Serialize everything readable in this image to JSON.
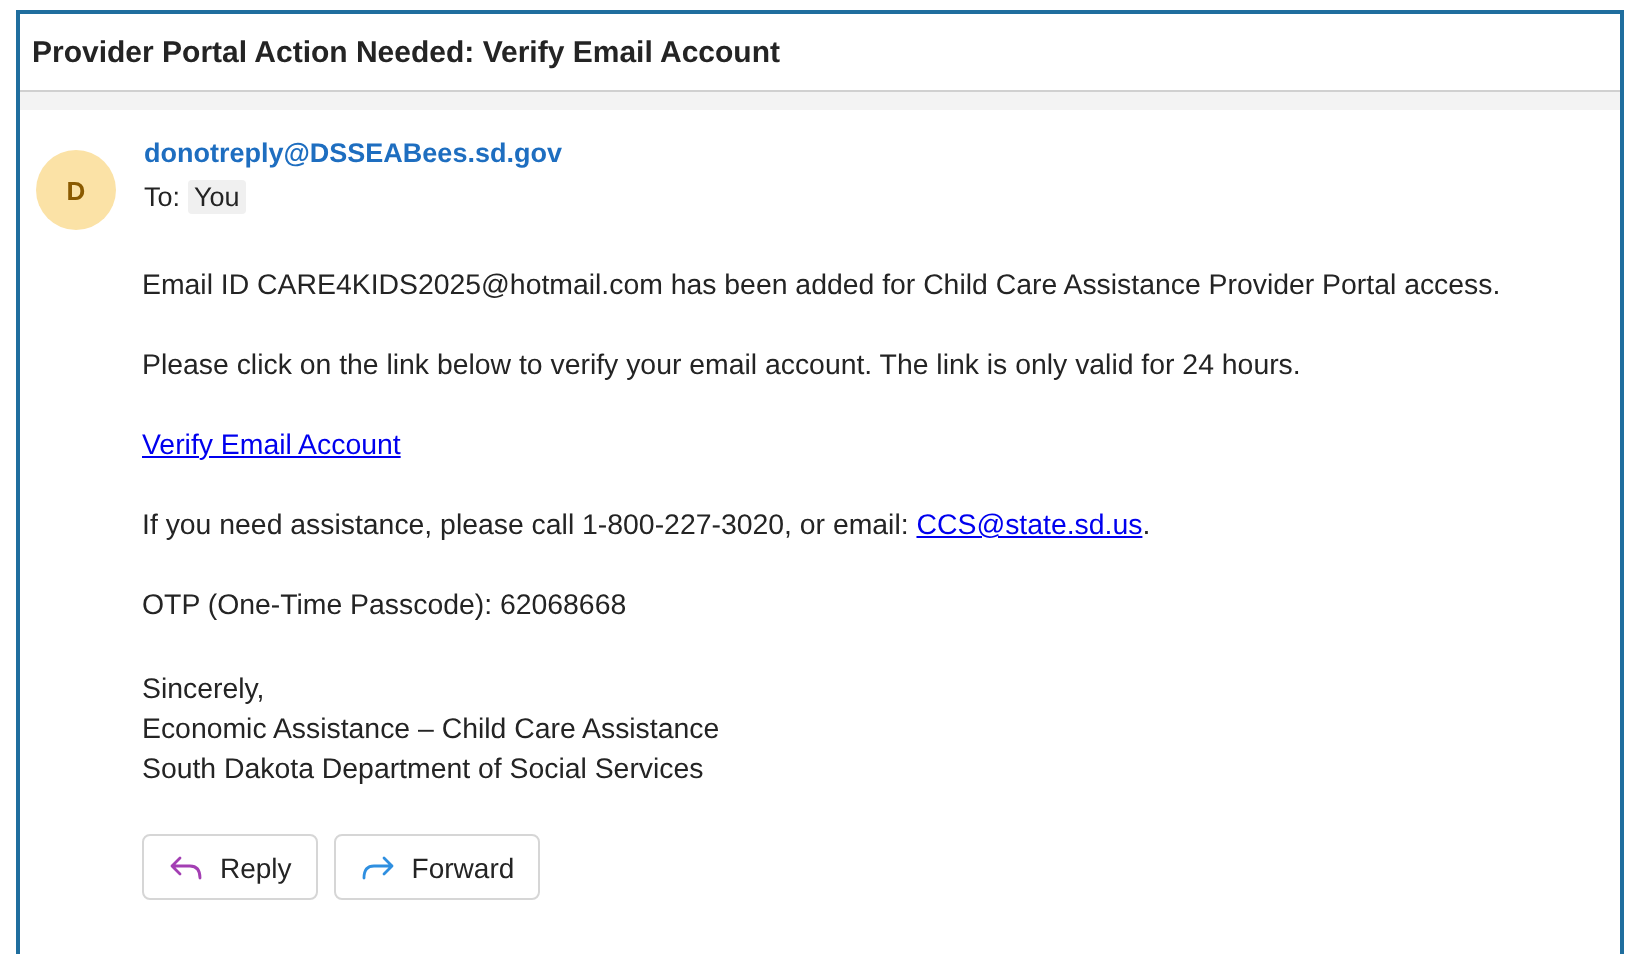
{
  "subject": "Provider Portal Action Needed: Verify Email Account",
  "sender": {
    "initial": "D",
    "address": "donotreply@DSSEABees.sd.gov",
    "to_label": "To:",
    "to": "You"
  },
  "body": [
    {
      "kind": "text",
      "text": "Email ID CARE4KIDS2025@hotmail.com has been added for Child Care Assistance Provider Portal access."
    },
    {
      "kind": "text",
      "text": "Please click on the link below to verify your email account. The link is only valid for 24 hours."
    },
    {
      "kind": "link",
      "text": "Verify Email Account"
    },
    {
      "kind": "text_with_link",
      "before": "If you need assistance, please call 1-800-227-3020, or email: ",
      "link": "CCS@state.sd.us",
      "after": "."
    },
    {
      "kind": "text",
      "text": "OTP (One-Time Passcode): 62068668"
    },
    {
      "kind": "lines",
      "lines": [
        "Sincerely,",
        "Economic Assistance – Child Care Assistance",
        "South Dakota Department of Social Services"
      ]
    }
  ],
  "actions": [
    {
      "kind": "reply",
      "label": "Reply"
    },
    {
      "kind": "forward",
      "label": "Forward"
    }
  ]
}
